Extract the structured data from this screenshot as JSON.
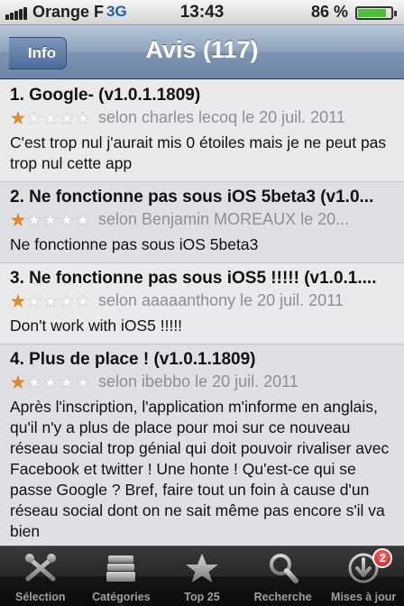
{
  "status_bar": {
    "carrier": "Orange F",
    "network": "3G",
    "time": "13:43",
    "battery": "86 %",
    "battery_level": 0.86
  },
  "nav": {
    "back_label": "Info",
    "title": "Avis (117)"
  },
  "reviews": [
    {
      "title": "1. Google- (v1.0.1.1809)",
      "rating": 1,
      "meta": "selon charles lecoq le 20 juil. 2011",
      "body": "C'est trop nul j'aurait mis 0 étoiles mais je ne peut pas trop nul cette app"
    },
    {
      "title": "2. Ne fonctionne pas sous iOS 5beta3 (v1.0...",
      "rating": 1,
      "meta": "selon Benjamin MOREAUX le 20...",
      "body": "Ne fonctionne pas sous iOS 5beta3"
    },
    {
      "title": "3. Ne fonctionne pas sous iOS5 !!!!! (v1.0.1....",
      "rating": 1,
      "meta": "selon aaaaanthony le 20 juil. 2011",
      "body": "Don't work with iOS5 !!!!!"
    },
    {
      "title": "4. Plus de place ! (v1.0.1.1809)",
      "rating": 1,
      "meta": "selon ibebbo le 20 juil. 2011",
      "body": "Après l'inscription, l'application m'informe en anglais, qu'il n'y a plus de place pour moi sur ce nouveau réseau social trop génial qui doit pouvoir rivaliser avec Facebook et twitter ! Une honte ! Qu'est-ce qui se passe Google ? Bref, faire tout un foin à cause d'un réseau social dont on ne sait même pas encore s'il va bien"
    }
  ],
  "tabs": [
    {
      "label": "Sélection",
      "icon": "selection-icon"
    },
    {
      "label": "Catégories",
      "icon": "categories-icon"
    },
    {
      "label": "Top 25",
      "icon": "star-icon"
    },
    {
      "label": "Recherche",
      "icon": "search-icon"
    },
    {
      "label": "Mises à jour",
      "icon": "updates-icon",
      "badge": "2"
    }
  ]
}
